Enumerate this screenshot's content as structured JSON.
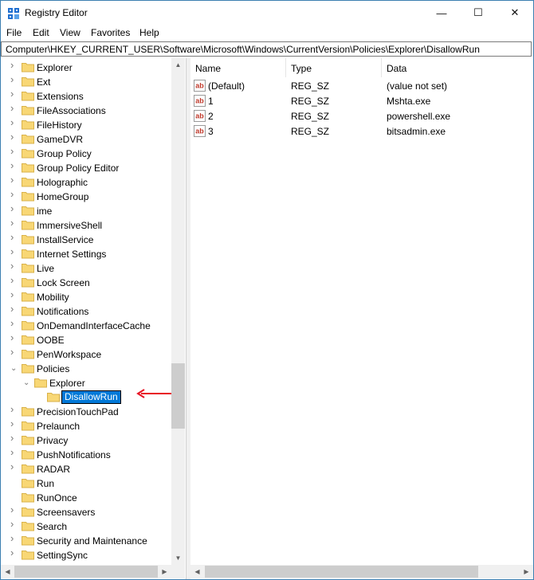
{
  "window": {
    "title": "Registry Editor",
    "minimize": "—",
    "maximize": "☐",
    "close": "✕"
  },
  "menu": [
    "File",
    "Edit",
    "View",
    "Favorites",
    "Help"
  ],
  "address": "Computer\\HKEY_CURRENT_USER\\Software\\Microsoft\\Windows\\CurrentVersion\\Policies\\Explorer\\DisallowRun",
  "tree": [
    {
      "label": "Explorer",
      "level": 0,
      "expander": "collapsed"
    },
    {
      "label": "Ext",
      "level": 0,
      "expander": "collapsed"
    },
    {
      "label": "Extensions",
      "level": 0,
      "expander": "collapsed"
    },
    {
      "label": "FileAssociations",
      "level": 0,
      "expander": "collapsed"
    },
    {
      "label": "FileHistory",
      "level": 0,
      "expander": "collapsed"
    },
    {
      "label": "GameDVR",
      "level": 0,
      "expander": "collapsed"
    },
    {
      "label": "Group Policy",
      "level": 0,
      "expander": "collapsed"
    },
    {
      "label": "Group Policy Editor",
      "level": 0,
      "expander": "collapsed"
    },
    {
      "label": "Holographic",
      "level": 0,
      "expander": "collapsed"
    },
    {
      "label": "HomeGroup",
      "level": 0,
      "expander": "collapsed"
    },
    {
      "label": "ime",
      "level": 0,
      "expander": "collapsed"
    },
    {
      "label": "ImmersiveShell",
      "level": 0,
      "expander": "collapsed"
    },
    {
      "label": "InstallService",
      "level": 0,
      "expander": "collapsed"
    },
    {
      "label": "Internet Settings",
      "level": 0,
      "expander": "collapsed"
    },
    {
      "label": "Live",
      "level": 0,
      "expander": "collapsed"
    },
    {
      "label": "Lock Screen",
      "level": 0,
      "expander": "collapsed"
    },
    {
      "label": "Mobility",
      "level": 0,
      "expander": "collapsed"
    },
    {
      "label": "Notifications",
      "level": 0,
      "expander": "collapsed"
    },
    {
      "label": "OnDemandInterfaceCache",
      "level": 0,
      "expander": "collapsed"
    },
    {
      "label": "OOBE",
      "level": 0,
      "expander": "collapsed"
    },
    {
      "label": "PenWorkspace",
      "level": 0,
      "expander": "collapsed"
    },
    {
      "label": "Policies",
      "level": 0,
      "expander": "expanded"
    },
    {
      "label": "Explorer",
      "level": 1,
      "expander": "expanded"
    },
    {
      "label": "DisallowRun",
      "level": 2,
      "expander": "none",
      "selected": true
    },
    {
      "label": "PrecisionTouchPad",
      "level": 0,
      "expander": "collapsed"
    },
    {
      "label": "Prelaunch",
      "level": 0,
      "expander": "collapsed"
    },
    {
      "label": "Privacy",
      "level": 0,
      "expander": "collapsed"
    },
    {
      "label": "PushNotifications",
      "level": 0,
      "expander": "collapsed"
    },
    {
      "label": "RADAR",
      "level": 0,
      "expander": "collapsed"
    },
    {
      "label": "Run",
      "level": 0,
      "expander": "none"
    },
    {
      "label": "RunOnce",
      "level": 0,
      "expander": "none"
    },
    {
      "label": "Screensavers",
      "level": 0,
      "expander": "collapsed"
    },
    {
      "label": "Search",
      "level": 0,
      "expander": "collapsed"
    },
    {
      "label": "Security and Maintenance",
      "level": 0,
      "expander": "collapsed"
    },
    {
      "label": "SettingSync",
      "level": 0,
      "expander": "collapsed"
    }
  ],
  "list": {
    "columns": [
      "Name",
      "Type",
      "Data"
    ],
    "rows": [
      {
        "name": "(Default)",
        "type": "REG_SZ",
        "data": "(value not set)"
      },
      {
        "name": "1",
        "type": "REG_SZ",
        "data": "Mshta.exe"
      },
      {
        "name": "2",
        "type": "REG_SZ",
        "data": "powershell.exe"
      },
      {
        "name": "3",
        "type": "REG_SZ",
        "data": "bitsadmin.exe"
      }
    ]
  },
  "icons": {
    "folder": "folder-icon",
    "value": "string-value-icon",
    "app": "registry-editor-icon",
    "pointer": "red-arrow-annotation"
  },
  "colors": {
    "selection": "#0078d7",
    "folder": "#f8d775",
    "arrow": "#e81123",
    "value_icon": "#c0392b"
  }
}
